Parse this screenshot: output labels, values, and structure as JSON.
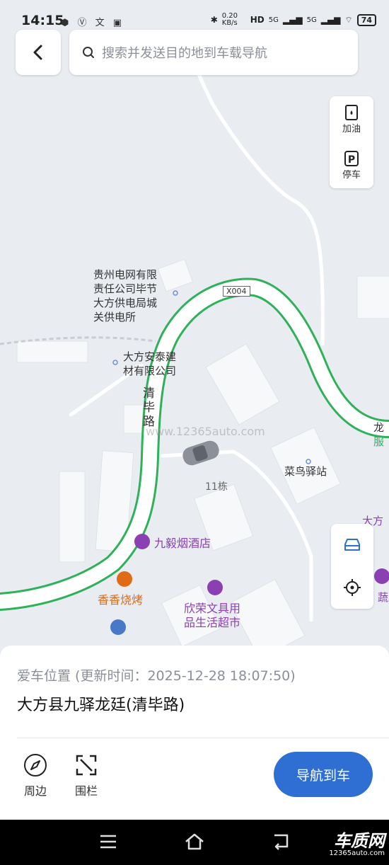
{
  "status_bar": {
    "time": "14:15",
    "left_icons": [
      "app-icon",
      "v-icon",
      "translate-icon",
      "nfc-icon"
    ],
    "net_speed": "0.20 KB/s",
    "signal_labels": [
      "HD",
      "5G",
      "5G"
    ],
    "battery": "74"
  },
  "search": {
    "placeholder": "搜索并发送目的地到车载导航"
  },
  "side_tools": [
    {
      "label": "加油",
      "icon": "fuel-icon"
    },
    {
      "label": "停车",
      "icon": "parking-icon"
    }
  ],
  "map": {
    "road_badge": "X004",
    "road_name": "清毕路",
    "building_label": "11栋",
    "pois": [
      {
        "name": "贵州电网有限\n责任公司毕节\n大方供电局城\n关供电所",
        "type": "plain"
      },
      {
        "name": "大方安泰建\n材有限公司",
        "type": "plain"
      },
      {
        "name": "菜鸟驿站",
        "type": "plain"
      },
      {
        "name": "九毅烟酒店",
        "type": "purple"
      },
      {
        "name": "香香烧烤",
        "type": "orange"
      },
      {
        "name": "欣荣文具用\n品生活超市",
        "type": "purple"
      }
    ],
    "edge_labels": [
      "龙",
      "服",
      "大方",
      "蔬"
    ],
    "watermark": "www.12365auto.com",
    "route_color": "#2fb15a"
  },
  "bottom_sheet": {
    "location_meta": "爱车位置 (更新时间：2025-12-28 18:07:50)",
    "address": "大方县九驿龙廷(清毕路)",
    "tools": [
      {
        "label": "周边",
        "icon": "compass-icon"
      },
      {
        "label": "围栏",
        "icon": "fence-icon"
      }
    ],
    "nav_button": "导航到车"
  },
  "brand": {
    "name": "车质网",
    "url": "12365auto.com"
  }
}
